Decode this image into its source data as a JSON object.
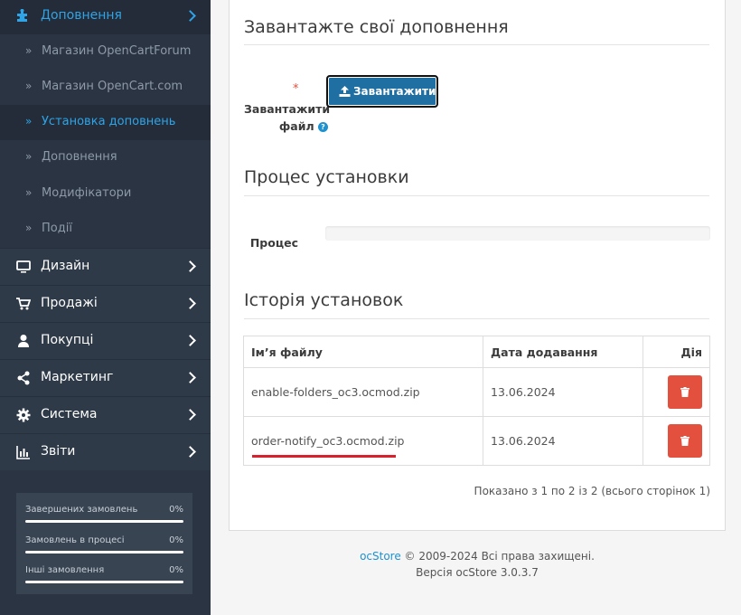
{
  "sidebar": {
    "active_section": "Доповнення",
    "sub_items": [
      {
        "label": "Магазин OpenCartForum",
        "active": false
      },
      {
        "label": "Магазин OpenCart.com",
        "active": false
      },
      {
        "label": "Установка доповнень",
        "active": true
      },
      {
        "label": "Доповнення",
        "active": false
      },
      {
        "label": "Модифікатори",
        "active": false
      },
      {
        "label": "Події",
        "active": false
      }
    ],
    "items": [
      {
        "label": "Дизайн",
        "icon": "desktop-icon"
      },
      {
        "label": "Продажі",
        "icon": "cart-icon"
      },
      {
        "label": "Покупці",
        "icon": "user-icon"
      },
      {
        "label": "Маркетинг",
        "icon": "share-icon"
      },
      {
        "label": "Система",
        "icon": "gear-icon"
      },
      {
        "label": "Звіти",
        "icon": "bar-chart-icon"
      }
    ],
    "stats": [
      {
        "label": "Завершених замовлень",
        "percent": "0%",
        "value": 0
      },
      {
        "label": "Замовлень в процесі",
        "percent": "0%",
        "value": 0
      },
      {
        "label": "Інші замовлення",
        "percent": "0%",
        "value": 0
      }
    ]
  },
  "upload": {
    "heading": "Завантажте свої доповнення",
    "required_mark": "*",
    "label_line1": "Завантажити",
    "label_line2": "файл",
    "help_icon": "?",
    "button_label": "Завантажити"
  },
  "process": {
    "heading": "Процес установки",
    "label": "Процес",
    "progress": 0
  },
  "history": {
    "heading": "Історія установок",
    "columns": [
      "Ім’я файлу",
      "Дата додавання",
      "Дія"
    ],
    "rows": [
      {
        "filename": "enable-folders_oc3.ocmod.zip",
        "date": "13.06.2024"
      },
      {
        "filename": "order-notify_oc3.ocmod.zip",
        "date": "13.06.2024"
      }
    ],
    "pagination_text": "Показано з 1 по 2 із 2 (всього сторінок 1)"
  },
  "footer": {
    "brand": "ocStore",
    "copyright": " © 2009-2024 Всі права захищені.",
    "version": "Версія ocStore 3.0.3.7"
  },
  "colors": {
    "sidebar_bg": "#2a3442",
    "accent": "#2fa4e7",
    "danger": "#e3503e",
    "upload_button": "#1f6fa3"
  }
}
